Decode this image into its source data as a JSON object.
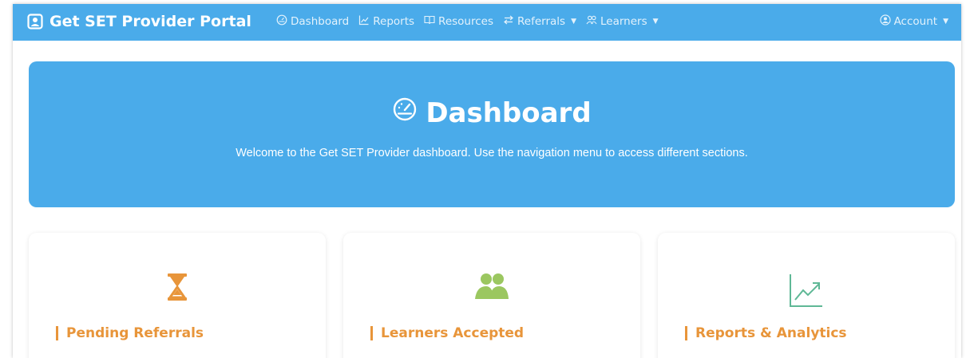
{
  "brand": {
    "title": "Get SET Provider Portal"
  },
  "nav": {
    "items": [
      {
        "label": "Dashboard",
        "icon": "dashboard-gauge-icon"
      },
      {
        "label": "Reports",
        "icon": "chart-line-icon"
      },
      {
        "label": "Resources",
        "icon": "book-open-icon"
      },
      {
        "label": "Referrals",
        "icon": "arrows-exchange-icon",
        "dropdown": true
      },
      {
        "label": "Learners",
        "icon": "users-icon",
        "dropdown": true
      }
    ],
    "account_label": "Account"
  },
  "hero": {
    "title": "Dashboard",
    "subtitle": "Welcome to the Get SET Provider dashboard. Use the navigation menu to access different sections."
  },
  "cards": [
    {
      "title": "Pending Referrals",
      "icon": "hourglass-icon",
      "color": "#e8953a"
    },
    {
      "title": "Learners Accepted",
      "icon": "users-icon",
      "color": "#e8953a",
      "icon_color": "#9bc760"
    },
    {
      "title": "Reports & Analytics",
      "icon": "chart-line-icon",
      "color": "#e8953a",
      "icon_color": "#5fb896"
    }
  ],
  "colors": {
    "primary": "#4aabea",
    "accent": "#e8953a"
  }
}
